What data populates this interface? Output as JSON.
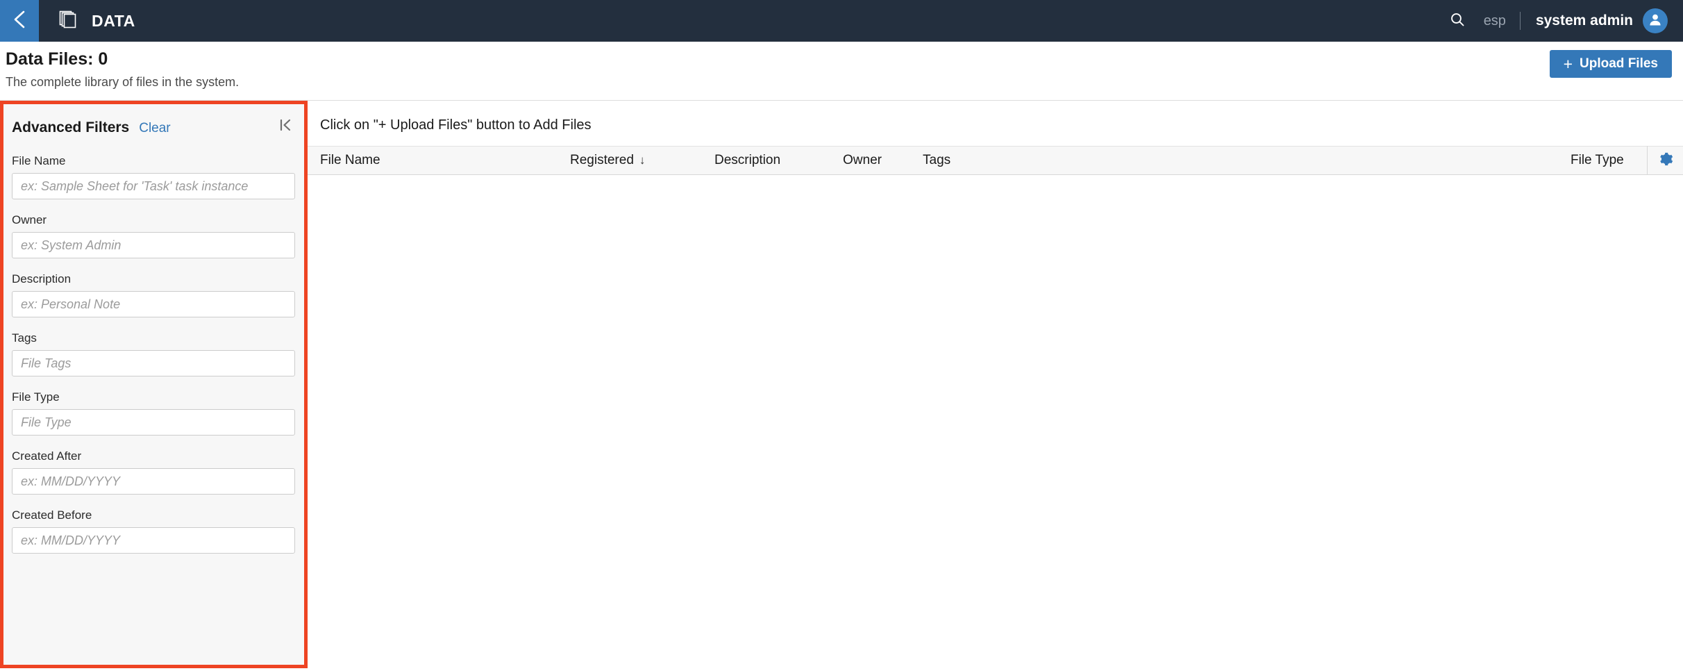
{
  "topnav": {
    "back_icon": "chevron-left-icon",
    "app_icon": "documents-stack-icon",
    "title": "DATA",
    "search_icon": "search-icon",
    "language": "esp",
    "user": "system admin",
    "avatar_icon": "user-avatar-icon",
    "colors": {
      "bar": "#232f3e",
      "accent": "#3478b8"
    }
  },
  "page": {
    "title": "Data Files: 0",
    "subtitle": "The complete library of files in the system.",
    "upload_button": "Upload Files",
    "upload_plus": "+"
  },
  "filters": {
    "heading": "Advanced Filters",
    "clear": "Clear",
    "collapse_icon": "collapse-panel-left-icon",
    "highlight_color": "#ee4423",
    "fields": [
      {
        "key": "file_name",
        "label": "File Name",
        "placeholder": "ex: Sample Sheet for 'Task' task instance",
        "value": ""
      },
      {
        "key": "owner",
        "label": "Owner",
        "placeholder": "ex: System Admin",
        "value": ""
      },
      {
        "key": "description",
        "label": "Description",
        "placeholder": "ex: Personal Note",
        "value": ""
      },
      {
        "key": "tags",
        "label": "Tags",
        "placeholder": "File Tags",
        "value": ""
      },
      {
        "key": "file_type",
        "label": "File Type",
        "placeholder": "File Type",
        "value": ""
      },
      {
        "key": "created_after",
        "label": "Created After",
        "placeholder": "ex: MM/DD/YYYY",
        "value": ""
      },
      {
        "key": "created_before",
        "label": "Created Before",
        "placeholder": "ex: MM/DD/YYYY",
        "value": ""
      }
    ]
  },
  "table": {
    "empty_message": "Click on \"+ Upload Files\" button to Add Files",
    "columns": [
      {
        "label": "File Name",
        "sorted": false
      },
      {
        "label": "Registered",
        "sorted": true,
        "sort_arrow": "↓"
      },
      {
        "label": "Description",
        "sorted": false
      },
      {
        "label": "Owner",
        "sorted": false
      },
      {
        "label": "Tags",
        "sorted": false
      },
      {
        "label": "File Type",
        "sorted": false
      }
    ],
    "settings_icon": "gear-icon",
    "settings_icon_color": "#3478b8",
    "rows": []
  }
}
